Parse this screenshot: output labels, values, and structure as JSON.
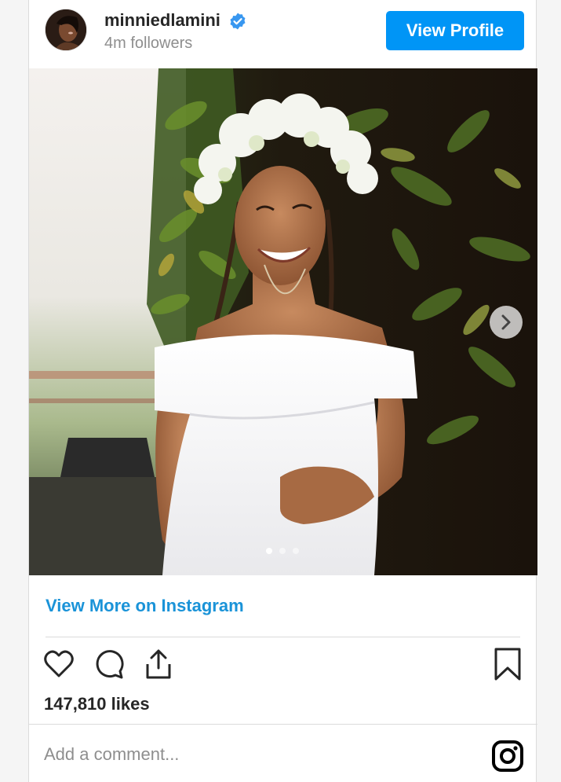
{
  "profile": {
    "username": "minniedlamini",
    "followers": "4m followers",
    "view_profile_label": "View Profile"
  },
  "post": {
    "carousel": {
      "total": 3,
      "active": 1
    },
    "view_more_label": "View More on Instagram",
    "likes": "147,810 likes",
    "comment_placeholder": "Add a comment..."
  },
  "colors": {
    "accent": "#0095f6",
    "link": "#1a93d8",
    "text": "#262626",
    "muted": "#8e8e8e",
    "divider": "#dbdbdb"
  },
  "icons": {
    "verified": "verified-badge-icon",
    "like": "heart-icon",
    "comment": "comment-bubble-icon",
    "share": "share-upload-icon",
    "save": "bookmark-icon",
    "instagram": "instagram-logo-icon",
    "next": "chevron-right-icon"
  }
}
